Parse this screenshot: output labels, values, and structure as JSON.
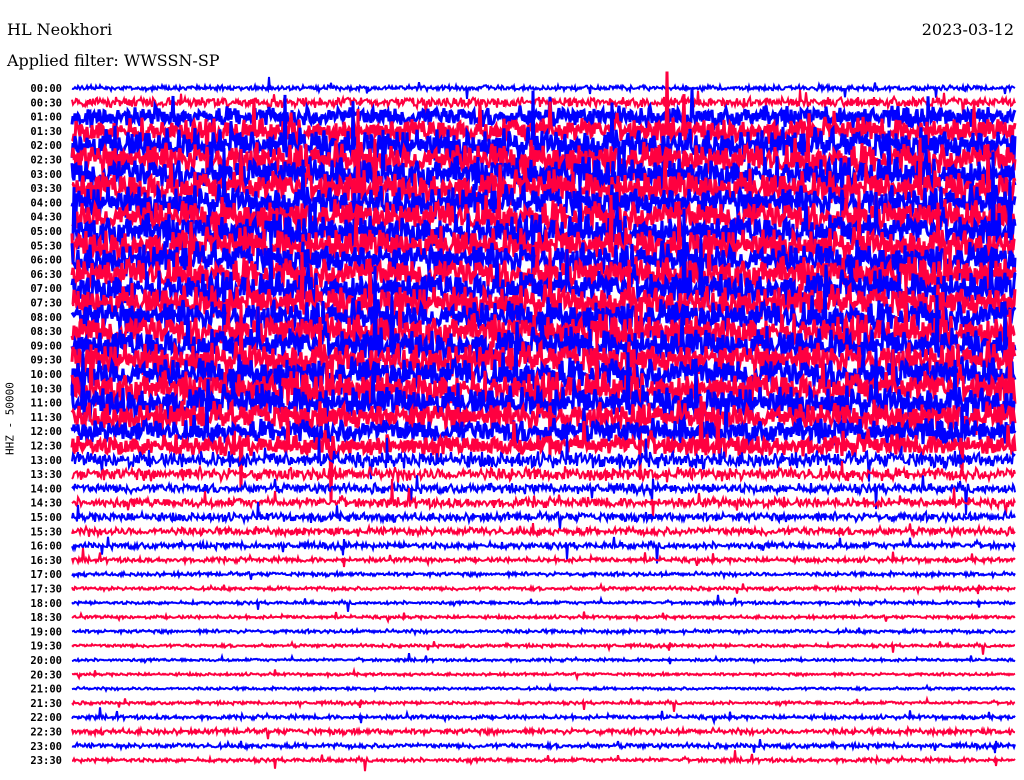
{
  "header": {
    "station": "HL Neokhori",
    "filter": "Applied filter: WWSSN-SP",
    "date": "2023-03-12"
  },
  "chart_data": {
    "type": "line",
    "title": "HL Neokhori",
    "subtitle": "Applied filter: WWSSN-SP",
    "ylabel": "HHZ - 50000",
    "xlabel": "",
    "row_interval_minutes": 30,
    "row_labels": [
      "00:00",
      "00:30",
      "01:00",
      "01:30",
      "02:00",
      "02:30",
      "03:00",
      "03:30",
      "04:00",
      "04:30",
      "05:00",
      "05:30",
      "06:00",
      "06:30",
      "07:00",
      "07:30",
      "08:00",
      "08:30",
      "09:00",
      "09:30",
      "10:00",
      "10:30",
      "11:00",
      "11:30",
      "12:00",
      "12:30",
      "13:00",
      "13:30",
      "14:00",
      "14:30",
      "15:00",
      "15:30",
      "16:00",
      "16:30",
      "17:00",
      "17:30",
      "18:00",
      "18:30",
      "19:00",
      "19:30",
      "20:00",
      "20:30",
      "21:00",
      "21:30",
      "22:00",
      "22:30",
      "23:00",
      "23:30"
    ],
    "series_colors": [
      "#0000ff",
      "#ff0040"
    ],
    "relative_noise_level": [
      0.6,
      1.2,
      2.5,
      3,
      4,
      4,
      4,
      4,
      4,
      4,
      4,
      4,
      4,
      4,
      4,
      4,
      4,
      4,
      4,
      4,
      4,
      4,
      4,
      3.5,
      3,
      2.5,
      2,
      1.6,
      1.2,
      1.2,
      1.1,
      1,
      0.8,
      0.6,
      0.5,
      0.45,
      0.4,
      0.4,
      0.45,
      0.4,
      0.35,
      0.35,
      0.35,
      0.4,
      0.5,
      0.7,
      0.6,
      0.5
    ]
  }
}
